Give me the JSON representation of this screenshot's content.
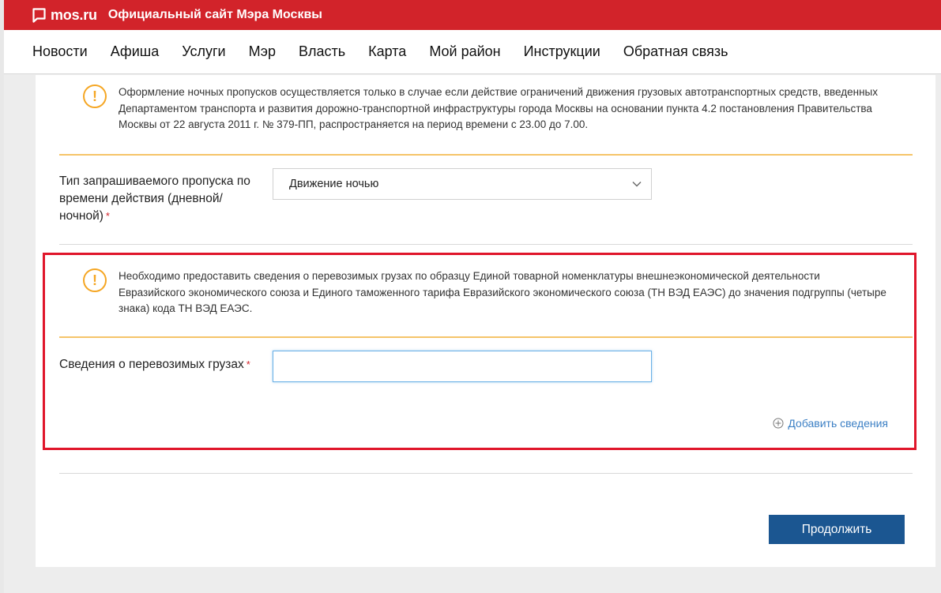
{
  "header": {
    "logo_text": "mos.ru",
    "site_title": "Официальный сайт Мэра Москвы",
    "brand_color": "#d2232a"
  },
  "nav": {
    "items": [
      {
        "label": "Новости"
      },
      {
        "label": "Афиша"
      },
      {
        "label": "Услуги"
      },
      {
        "label": "Мэр"
      },
      {
        "label": "Власть"
      },
      {
        "label": "Карта"
      },
      {
        "label": "Мой район"
      },
      {
        "label": "Инструкции"
      },
      {
        "label": "Обратная связь"
      }
    ]
  },
  "form": {
    "notice_night": {
      "icon": "warning-icon",
      "symbol": "!",
      "text": "Оформление ночных пропусков осуществляется только в случае если действие ограничений движения грузовых автотранспортных средств, введенных Департаментом транспорта и развития дорожно-транспортной инфраструктуры города Москвы на основании пункта 4.2 постановления Правительства Москвы от 22 августа 2011 г. № 379-ПП, распространяется на период времени с 23.00 до 7.00."
    },
    "pass_type": {
      "label": "Тип запрашиваемого пропуска по времени действия (дневной/ночной)",
      "required_mark": "*",
      "selected_value": "Движение ночью"
    },
    "notice_cargo": {
      "icon": "warning-icon",
      "symbol": "!",
      "text": "Необходимо предоставить сведения о перевозимых грузах по образцу Единой товарной номенклатуры внешнеэкономической деятельности Евразийского экономического союза и Единого таможенного тарифа Евразийского экономического союза (ТН ВЭД ЕАЭС) до значения подгруппы (четыре знака) кода ТН ВЭД ЕАЭС."
    },
    "cargo_info": {
      "label": "Сведения о перевозимых грузах",
      "required_mark": "*",
      "value": ""
    },
    "add_link": "Добавить сведения",
    "continue_button": "Продолжить"
  },
  "colors": {
    "accent_orange": "#f5a623",
    "link_blue": "#3b7fc4",
    "button_blue": "#1b5691",
    "highlight_red": "#e0162b"
  }
}
